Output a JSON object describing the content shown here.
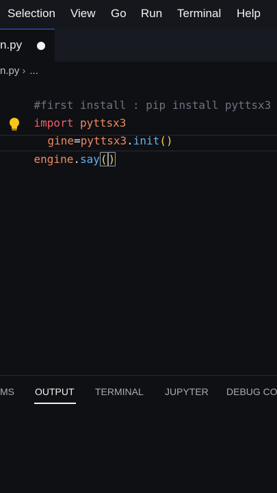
{
  "menu": {
    "items": [
      "Selection",
      "View",
      "Go",
      "Run",
      "Terminal",
      "Help"
    ]
  },
  "tab": {
    "label": "n.py"
  },
  "breadcrumb": {
    "file": "n.py",
    "separator": "›",
    "more": "..."
  },
  "code": {
    "line1_comment": "#first install : pip install pyttsx3",
    "line2_keyword": "import",
    "line2_module": "pyttsx3",
    "line3_var": "gine",
    "line3_eq": "=",
    "line3_module": "pyttsx3",
    "line3_dot": ".",
    "line3_func": "init",
    "line3_parens": "()",
    "line4_var": "engine",
    "line4_dot": ".",
    "line4_func": "say",
    "line4_open": "(",
    "line4_close": ")"
  },
  "panel": {
    "tabs": [
      "MS",
      "OUTPUT",
      "TERMINAL",
      "JUPYTER",
      "DEBUG CO"
    ],
    "active": "OUTPUT"
  },
  "colors": {
    "background": "#0f1014",
    "comment": "#6e7381",
    "keyword": "#ef5f6a",
    "module": "#f08a5d",
    "function": "#5fb3f0",
    "paren": "#f2d24e",
    "bulb": "#f5c518"
  },
  "icons": {
    "unsaved": "unsaved-dot-icon",
    "lightbulb": "lightbulb-icon"
  }
}
